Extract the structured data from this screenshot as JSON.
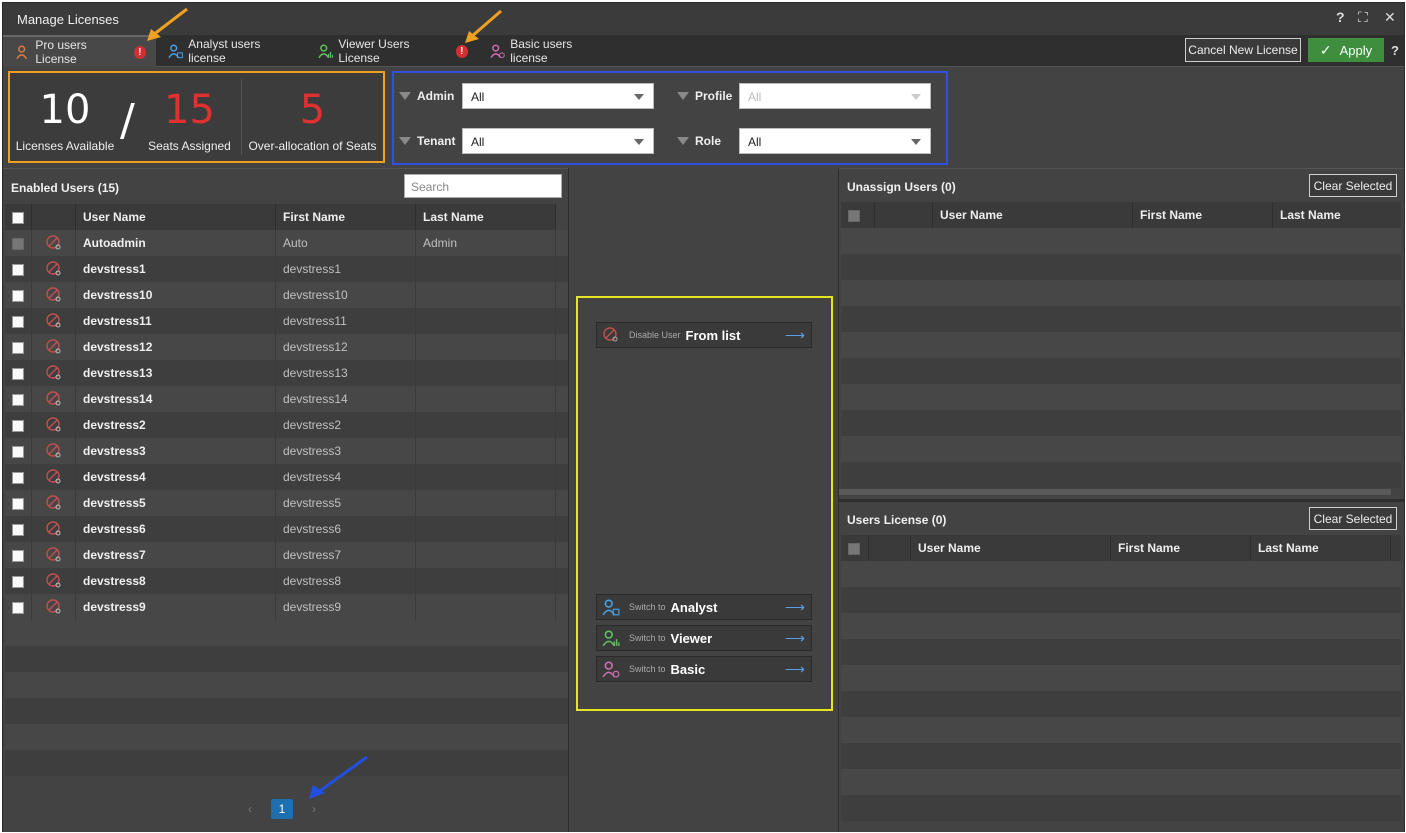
{
  "window": {
    "title": "Manage Licenses",
    "help": "?",
    "maximize": "⛶",
    "close": "✕"
  },
  "tabs": [
    {
      "label": "Pro users License",
      "warning": "!"
    },
    {
      "label": "Analyst users license"
    },
    {
      "label": "Viewer Users License",
      "warning": "!"
    },
    {
      "label": "Basic users license"
    }
  ],
  "toolbar": {
    "cancel_label": "Cancel New License",
    "apply_label": "Apply",
    "apply_icon": "✓",
    "help": "?"
  },
  "stats": {
    "available_value": "10",
    "available_label": "Licenses Available",
    "slash": "/",
    "assigned_value": "15",
    "assigned_label": "Seats Assigned",
    "over_value": "5",
    "over_label": "Over-allocation of Seats"
  },
  "filters": {
    "admin_label": "Admin",
    "admin_value": "All",
    "profile_label": "Profile",
    "profile_value": "All",
    "tenant_label": "Tenant",
    "tenant_value": "All",
    "role_label": "Role",
    "role_value": "All"
  },
  "enabled": {
    "title": "Enabled Users (15)",
    "search_placeholder": "Search",
    "columns": [
      "User Name",
      "First Name",
      "Last Name"
    ],
    "rows": [
      {
        "user": "Autoadmin",
        "first": "Auto",
        "last": "Admin"
      },
      {
        "user": "devstress1",
        "first": "devstress1",
        "last": ""
      },
      {
        "user": "devstress10",
        "first": "devstress10",
        "last": ""
      },
      {
        "user": "devstress11",
        "first": "devstress11",
        "last": ""
      },
      {
        "user": "devstress12",
        "first": "devstress12",
        "last": ""
      },
      {
        "user": "devstress13",
        "first": "devstress13",
        "last": ""
      },
      {
        "user": "devstress14",
        "first": "devstress14",
        "last": ""
      },
      {
        "user": "devstress2",
        "first": "devstress2",
        "last": ""
      },
      {
        "user": "devstress3",
        "first": "devstress3",
        "last": ""
      },
      {
        "user": "devstress4",
        "first": "devstress4",
        "last": ""
      },
      {
        "user": "devstress5",
        "first": "devstress5",
        "last": ""
      },
      {
        "user": "devstress6",
        "first": "devstress6",
        "last": ""
      },
      {
        "user": "devstress7",
        "first": "devstress7",
        "last": ""
      },
      {
        "user": "devstress8",
        "first": "devstress8",
        "last": ""
      },
      {
        "user": "devstress9",
        "first": "devstress9",
        "last": ""
      }
    ],
    "pager": {
      "prev": "‹",
      "current": "1",
      "next": "›"
    }
  },
  "actions": {
    "disable": {
      "small": "Disable User",
      "big": "From list",
      "arrow": "⟶"
    },
    "analyst": {
      "small": "Switch to",
      "big": "Analyst",
      "arrow": "⟶"
    },
    "viewer": {
      "small": "Switch to",
      "big": "Viewer",
      "arrow": "⟶"
    },
    "basic": {
      "small": "Switch to",
      "big": "Basic",
      "arrow": "⟶"
    }
  },
  "unassign": {
    "title": "Unassign Users (0)",
    "clear_label": "Clear Selected",
    "columns": [
      "User Name",
      "First Name",
      "Last Name"
    ]
  },
  "users_license": {
    "title": "Users License (0)",
    "clear_label": "Clear Selected",
    "columns": [
      "User Name",
      "First Name",
      "Last Name"
    ]
  },
  "colors": {
    "accent_red": "#e03030",
    "apply_green": "#3e8e3e",
    "highlight_orange": "#f0a020",
    "highlight_blue": "#3050e0",
    "highlight_yellow": "#e5e520"
  }
}
